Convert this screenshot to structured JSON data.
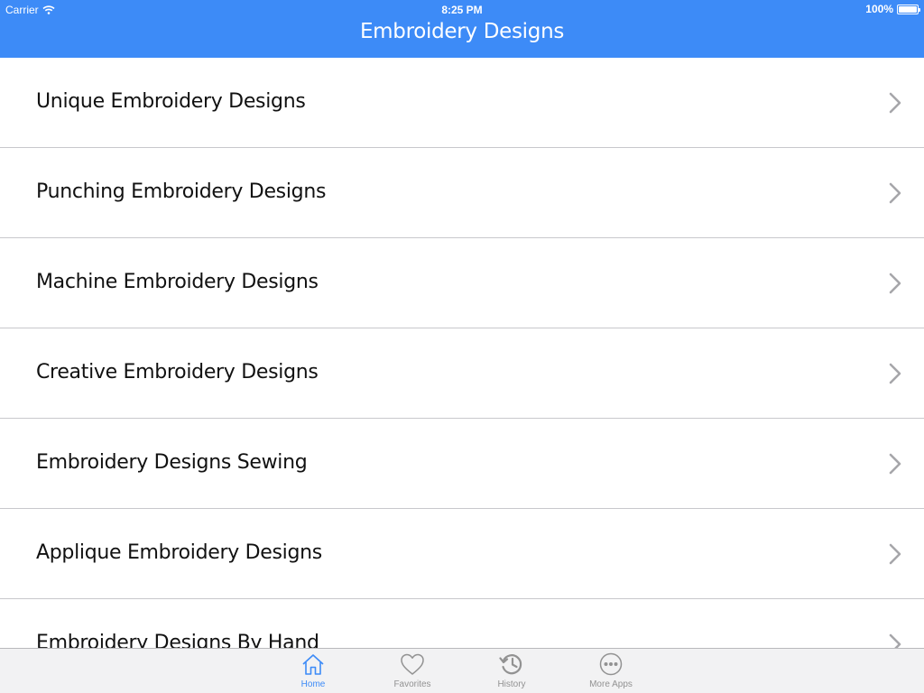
{
  "status_bar": {
    "carrier": "Carrier",
    "time": "8:25 PM",
    "battery": "100%",
    "battery_level": 1.0
  },
  "nav": {
    "title": "Embroidery Designs"
  },
  "list": {
    "items": [
      {
        "label": "Unique Embroidery Designs"
      },
      {
        "label": "Punching Embroidery Designs"
      },
      {
        "label": "Machine Embroidery Designs"
      },
      {
        "label": "Creative Embroidery Designs"
      },
      {
        "label": "Embroidery Designs Sewing"
      },
      {
        "label": "Applique Embroidery Designs"
      },
      {
        "label": "Embroidery Designs By Hand"
      }
    ]
  },
  "tabbar": {
    "tabs": [
      {
        "label": "Home",
        "icon": "home-icon",
        "active": true
      },
      {
        "label": "Favorites",
        "icon": "heart-icon",
        "active": false
      },
      {
        "label": "History",
        "icon": "history-icon",
        "active": false
      },
      {
        "label": "More Apps",
        "icon": "more-icon",
        "active": false
      }
    ]
  },
  "colors": {
    "accent": "#3d8bf7",
    "separator": "#c8c8cc",
    "tab_inactive": "#929292"
  }
}
